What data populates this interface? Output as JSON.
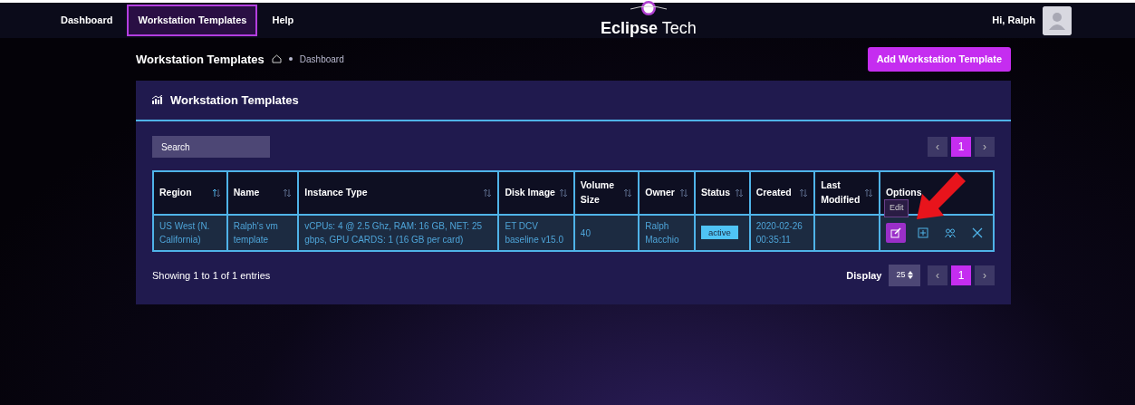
{
  "nav": {
    "items": [
      {
        "label": "Dashboard",
        "selected": false
      },
      {
        "label": "Workstation Templates",
        "selected": true
      },
      {
        "label": "Help",
        "selected": false
      }
    ],
    "brand": "**Eclipse** Tech",
    "greeting": "Hi, Ralph"
  },
  "header": {
    "title": "Workstation Templates",
    "breadcrumb": "Dashboard",
    "add_button": "Add Workstation Template"
  },
  "card": {
    "title": "Workstation Templates",
    "search": {
      "placeholder": "Search"
    },
    "pagination_top": [
      {
        "label": "‹",
        "selected": false
      },
      {
        "label": "1",
        "selected": true
      },
      {
        "label": "›",
        "selected": false
      }
    ],
    "table": {
      "columns": [
        {
          "label": "Region",
          "sortable": true,
          "sorted": true
        },
        {
          "label": "Name",
          "sortable": true,
          "sorted": false
        },
        {
          "label": "Instance Type",
          "sortable": true,
          "sorted": false
        },
        {
          "label": "Disk Image",
          "sortable": true,
          "sorted": false
        },
        {
          "label": "Volume Size",
          "sortable": true,
          "sorted": false
        },
        {
          "label": "Owner",
          "sortable": true,
          "sorted": false
        },
        {
          "label": "Status",
          "sortable": true,
          "sorted": false
        },
        {
          "label": "Created",
          "sortable": true,
          "sorted": false
        },
        {
          "label": "Last Modified",
          "sortable": true,
          "sorted": false
        },
        {
          "label": "Options",
          "sortable": false
        }
      ],
      "rows": [
        {
          "cells": [
            {
              "kind": "text",
              "text": "US West (N. California)"
            },
            {
              "kind": "text",
              "text": "Ralph's vm template"
            },
            {
              "kind": "text",
              "text": "vCPUs: 4 @ 2.5 Ghz, RAM: 16 GB, NET: 25 gbps, GPU CARDS: 1 (16 GB per card)"
            },
            {
              "kind": "text",
              "text": "ET DCV baseline v15.0"
            },
            {
              "kind": "text",
              "text": "40"
            },
            {
              "kind": "text",
              "text": "Ralph Macchio"
            },
            {
              "kind": "badge",
              "text": "active"
            },
            {
              "kind": "text",
              "text": "2020-02-26 00:35:11"
            },
            {
              "kind": "text"
            },
            {
              "kind": "options",
              "tooltip": "Edit",
              "actions": [
                {
                  "kind": "edit",
                  "selected": true
                },
                {
                  "kind": "add",
                  "selected": false
                },
                {
                  "kind": "users",
                  "selected": false
                },
                {
                  "kind": "delete",
                  "selected": false
                }
              ]
            }
          ]
        }
      ]
    },
    "footer": {
      "info": "Showing 1 to 1 of 1 entries",
      "display_label": "Display",
      "display_value": "25",
      "pagination": [
        {
          "label": "‹",
          "selected": false
        },
        {
          "label": "1",
          "selected": true
        },
        {
          "label": "›",
          "selected": false
        }
      ]
    }
  }
}
